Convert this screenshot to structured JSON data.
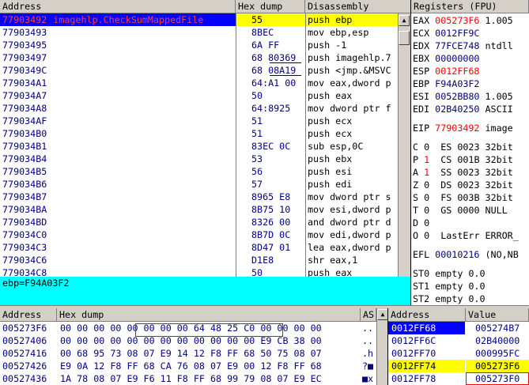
{
  "cpu_headers": {
    "address": "Address",
    "hex": "Hex dump",
    "disasm": "Disassembly",
    "registers": "Registers (FPU)"
  },
  "cpu_rows": [
    {
      "addr": "77903492",
      "label": "imagehlp.CheckSumMappedFile",
      "hex": "55",
      "dis": "push ebp",
      "selected": true
    },
    {
      "addr": "77903493",
      "hex": "8BEC",
      "dis": "mov ebp,esp"
    },
    {
      "addr": "77903495",
      "hex": "6A FF",
      "dis": "push -1"
    },
    {
      "addr": "77903497",
      "hex": "68 80369",
      "dis": "push imagehlp.7"
    },
    {
      "addr": "7790349C",
      "hex": "68 08A19",
      "dis": "push <jmp.&MSVC"
    },
    {
      "addr": "779034A1",
      "hex": "64:A1 00",
      "dis": "mov eax,dword p"
    },
    {
      "addr": "779034A7",
      "hex": "50",
      "dis": "push eax"
    },
    {
      "addr": "779034A8",
      "hex": "64:8925",
      "dis": "mov dword ptr f"
    },
    {
      "addr": "779034AF",
      "hex": "51",
      "dis": "push ecx"
    },
    {
      "addr": "779034B0",
      "hex": "51",
      "dis": "push ecx"
    },
    {
      "addr": "779034B1",
      "hex": "83EC 0C",
      "dis": "sub esp,0C"
    },
    {
      "addr": "779034B4",
      "hex": "53",
      "dis": "push ebx"
    },
    {
      "addr": "779034B5",
      "hex": "56",
      "dis": "push esi"
    },
    {
      "addr": "779034B6",
      "hex": "57",
      "dis": "push edi"
    },
    {
      "addr": "779034B7",
      "hex": "8965 E8",
      "dis": "mov dword ptr s"
    },
    {
      "addr": "779034BA",
      "hex": "8B75 10",
      "dis": "mov esi,dword p"
    },
    {
      "addr": "779034BD",
      "hex": "8326 00",
      "dis": "and dword ptr d"
    },
    {
      "addr": "779034C0",
      "hex": "8B7D 0C",
      "dis": "mov edi,dword p"
    },
    {
      "addr": "779034C3",
      "hex": "8D47 01",
      "dis": "lea eax,dword p"
    },
    {
      "addr": "779034C6",
      "hex": "D1E8",
      "dis": "shr eax,1"
    },
    {
      "addr": "779034C8",
      "hex": "50",
      "dis": "push eax"
    }
  ],
  "info_line": "ebp=F94A03F2",
  "registers": [
    {
      "name": "EAX",
      "value": "005273F6",
      "extra": " 1.005",
      "red": true
    },
    {
      "name": "ECX",
      "value": "0012FF9C",
      "extra": ""
    },
    {
      "name": "EDX",
      "value": "77FCE748",
      "extra": " ntdll"
    },
    {
      "name": "EBX",
      "value": "00000000",
      "extra": ""
    },
    {
      "name": "ESP",
      "value": "0012FF68",
      "extra": "",
      "red": true
    },
    {
      "name": "EBP",
      "value": "F94A03F2",
      "extra": ""
    },
    {
      "name": "ESI",
      "value": "0052BB80",
      "extra": " 1.005"
    },
    {
      "name": "EDI",
      "value": "02B40250",
      "extra": " ASCII"
    }
  ],
  "eip": {
    "name": "EIP",
    "value": "77903492",
    "extra": " image"
  },
  "flags": [
    {
      "f": "C",
      "v": "0",
      "seg": "ES",
      "sv": "0023",
      "d": "32bit"
    },
    {
      "f": "P",
      "v": "1",
      "seg": "CS",
      "sv": "001B",
      "d": "32bit",
      "red": true
    },
    {
      "f": "A",
      "v": "1",
      "seg": "SS",
      "sv": "0023",
      "d": "32bit",
      "red": true
    },
    {
      "f": "Z",
      "v": "0",
      "seg": "DS",
      "sv": "0023",
      "d": "32bit"
    },
    {
      "f": "S",
      "v": "0",
      "seg": "FS",
      "sv": "003B",
      "d": "32bit"
    },
    {
      "f": "T",
      "v": "0",
      "seg": "GS",
      "sv": "0000",
      "d": "NULL"
    },
    {
      "f": "D",
      "v": "0",
      "seg": "",
      "sv": "",
      "d": ""
    },
    {
      "f": "O",
      "v": "0",
      "seg": "",
      "sv": "",
      "d": "LastErr ERROR_"
    }
  ],
  "efl": {
    "name": "EFL",
    "value": "00010216",
    "extra": " (NO,NB"
  },
  "fpu": [
    {
      "name": "ST0",
      "value": "empty 0.0"
    },
    {
      "name": "ST1",
      "value": "empty 0.0"
    },
    {
      "name": "ST2",
      "value": "empty 0.0"
    }
  ],
  "dump_headers": {
    "address": "Address",
    "hex": "Hex dump",
    "ascii": "AS"
  },
  "dump_rows": [
    {
      "addr": "005273F6",
      "hex": "00 00 00 00 00 00 00 00 64 48 25 C0 00 00 00 00",
      "ascii": ".."
    },
    {
      "addr": "00527406",
      "hex": "00 00 00 00 00 00 00 00 00 00 00 00 E9 CB 38 00",
      "ascii": ".."
    },
    {
      "addr": "00527416",
      "hex": "00 68 95 73 08 07 E9 14 12 F8 FF 68 50 75 08 07",
      "ascii": ".h"
    },
    {
      "addr": "00527426",
      "hex": "E9 0A 12 F8 FF 68 CA 76 08 07 E9 00 12 F8 FF 68",
      "ascii": "?■"
    },
    {
      "addr": "00527436",
      "hex": "1A 78 08 07 E9 F6 11 F8 FF 68 99 79 08 07 E9 EC",
      "ascii": "■x"
    }
  ],
  "stack_headers": {
    "address": "Address",
    "value": "Value"
  },
  "stack_rows": [
    {
      "addr": "0012FF68",
      "value": "005274B7",
      "sel": "blue"
    },
    {
      "addr": "0012FF6C",
      "value": "02B40000"
    },
    {
      "addr": "0012FF70",
      "value": "000995FC"
    },
    {
      "addr": "0012FF74",
      "value": "005273F6",
      "sel": "yellow"
    },
    {
      "addr": "0012FF78",
      "value": "005273F0",
      "boxed": true
    }
  ]
}
